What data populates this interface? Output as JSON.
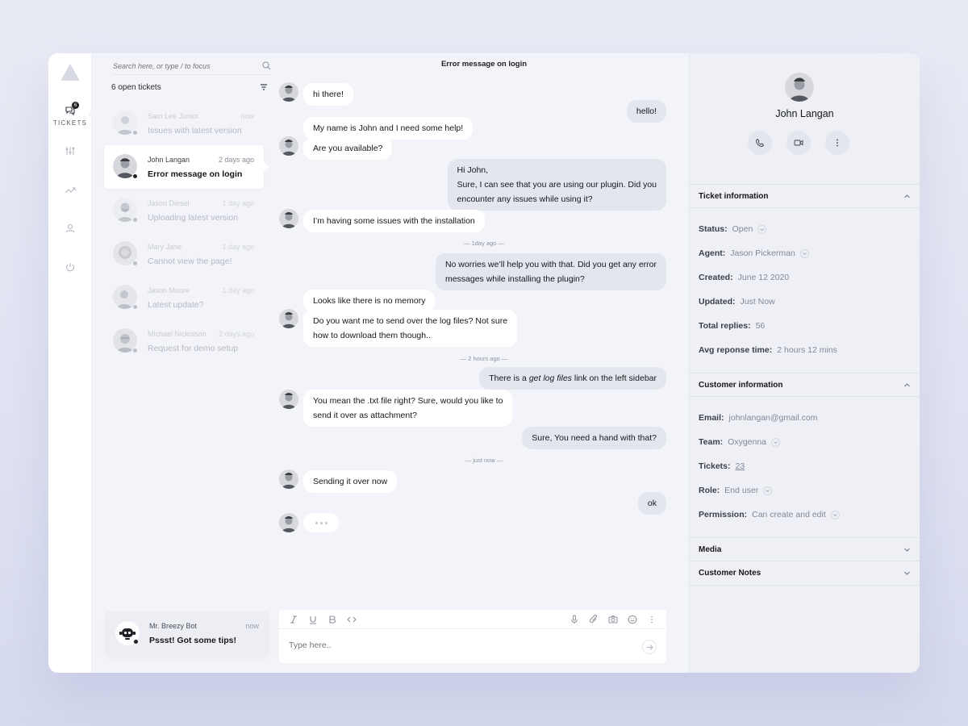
{
  "rail": {
    "tickets_label": "TICKETS",
    "tickets_badge": "6"
  },
  "list": {
    "search_placeholder": "Search here, or type / to focus",
    "open_count": "6 open tickets",
    "tickets": [
      {
        "name": "Sam Lee Junior",
        "time": "now",
        "subject": "Issues with latest version"
      },
      {
        "name": "John Langan",
        "time": "2 days ago",
        "subject": "Error message on login"
      },
      {
        "name": "Jason Diesel",
        "time": "1 day ago",
        "subject": "Uploading latest version"
      },
      {
        "name": "Mary Jane",
        "time": "1 day ago",
        "subject": "Cannot view the page!"
      },
      {
        "name": "Jason Moore",
        "time": "1 day ago",
        "subject": "Latest update?"
      },
      {
        "name": "Michael Nickolson",
        "time": "2 days ago",
        "subject": "Request for demo setup"
      }
    ],
    "bot": {
      "name": "Mr. Breezy Bot",
      "time": "now",
      "message": "Pssst! Got some tips!"
    }
  },
  "chat": {
    "title": "Error message on login",
    "messages": [
      {
        "text": "hi there!"
      },
      {
        "text": "hello!"
      },
      {
        "text": "My name is John and I need some help!"
      },
      {
        "text": "Are you available?"
      },
      {
        "line1": "Hi John,",
        "line2": "Sure, I can see that you are using our plugin. Did you",
        "line3": "encounter any issues while using it?"
      },
      {
        "text": "I’m having some issues with the installation"
      },
      {
        "line1": "No worries we’ll help you with that. Did you get any error",
        "line2": "messages while installing the plugin?"
      },
      {
        "text": "Looks like there is no memory"
      },
      {
        "line1": "Do you want me to send over the log files? Not sure",
        "line2": "how to download them though.."
      },
      {
        "pre": "There is a ",
        "em": "get log files",
        "post": " link on the left sidebar"
      },
      {
        "line1": "You mean the .txt file right? Sure, would you like to",
        "line2": "send it over as attachment?"
      },
      {
        "text": "Sure, You need a hand with that?"
      },
      {
        "text": "Sending it over now"
      },
      {
        "text": "ok"
      }
    ],
    "dividers": [
      "— 1day ago —",
      "— 2 hours ago —",
      "— just now —"
    ],
    "composer_placeholder": "Type here.."
  },
  "customer": {
    "name": "John Langan",
    "ticket_section": "Ticket  information",
    "status_label": "Status:",
    "status": "Open",
    "agent_label": "Agent:",
    "agent": "Jason Pickerman",
    "created_label": "Created:",
    "created": "June 12 2020",
    "updated_label": "Updated:",
    "updated": "Just Now",
    "replies_label": "Total replies:",
    "replies": "56",
    "avg_label": "Avg reponse time:",
    "avg": "2 hours 12 mins",
    "customer_section": "Customer  information",
    "email_label": "Email:",
    "email": "johnlangan@gmail.com",
    "team_label": "Team:",
    "team": "Oxygenna",
    "tickets_label": "Tickets:",
    "tickets": "23",
    "role_label": "Role:",
    "role": "End user",
    "permission_label": "Permission:",
    "permission": "Can create and edit",
    "media_section": "Media",
    "notes_section": "Customer Notes"
  },
  "colors": {
    "accent": "#15171c",
    "surface": "#f3f4f9",
    "bubble_out": "#e4e6ed"
  }
}
